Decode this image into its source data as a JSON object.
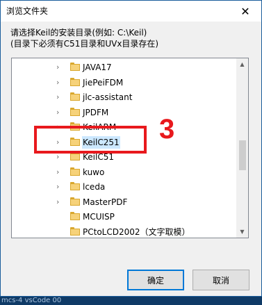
{
  "window": {
    "title": "浏览文件夹",
    "close_glyph": "✕"
  },
  "description": {
    "line1": "请选择Keil的安装目录(例如: C:\\Keil)",
    "line2": "(目录下必须有C51目录和UVx目录存在)"
  },
  "tree": {
    "items": [
      {
        "label": "JAVA17",
        "has_children": true,
        "selected": false
      },
      {
        "label": "JiePeiFDM",
        "has_children": true,
        "selected": false
      },
      {
        "label": "jlc-assistant",
        "has_children": true,
        "selected": false
      },
      {
        "label": "JPDFM",
        "has_children": true,
        "selected": false
      },
      {
        "label": "KeilARM",
        "has_children": true,
        "selected": false
      },
      {
        "label": "KeilC251",
        "has_children": true,
        "selected": true
      },
      {
        "label": "KeilC51",
        "has_children": true,
        "selected": false
      },
      {
        "label": "kuwo",
        "has_children": true,
        "selected": false
      },
      {
        "label": "lceda",
        "has_children": true,
        "selected": false
      },
      {
        "label": "MasterPDF",
        "has_children": true,
        "selected": false
      },
      {
        "label": "MCUISP",
        "has_children": false,
        "selected": false
      },
      {
        "label": "PCtoLCD2002（文字取模）",
        "has_children": false,
        "selected": false
      }
    ],
    "arrow_glyph": "›",
    "scroll_up_glyph": "▲",
    "scroll_down_glyph": "▼"
  },
  "annotation": {
    "number": "3",
    "color": "#e8191d"
  },
  "buttons": {
    "ok": "确定",
    "cancel": "取消"
  },
  "background_text": "mcs-4 vsCode 00"
}
